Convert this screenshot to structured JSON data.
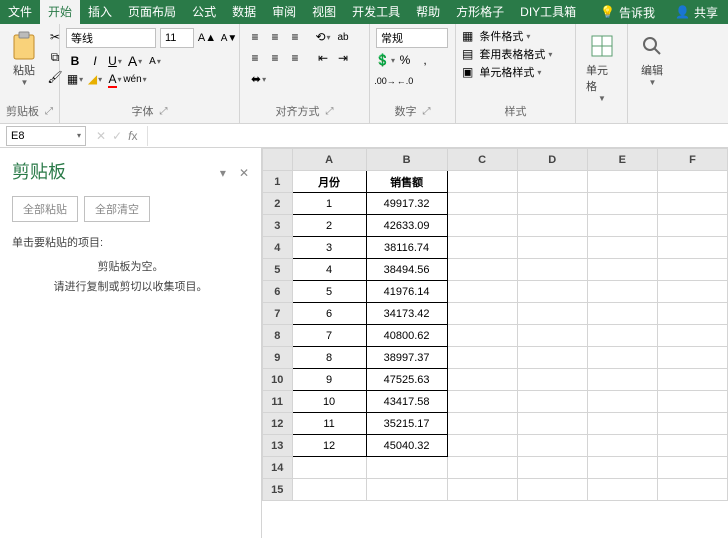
{
  "menu": {
    "items": [
      "文件",
      "开始",
      "插入",
      "页面布局",
      "公式",
      "数据",
      "审阅",
      "视图",
      "开发工具",
      "帮助",
      "方形格子",
      "DIY工具箱"
    ],
    "active_index": 1,
    "tell_me": "告诉我",
    "share": "共享"
  },
  "ribbon": {
    "clipboard": {
      "paste": "粘贴",
      "label": "剪贴板"
    },
    "font": {
      "name": "等线",
      "size": "11",
      "label": "字体"
    },
    "align": {
      "label": "对齐方式"
    },
    "number": {
      "format": "常规",
      "label": "数字"
    },
    "styles": {
      "cond": "条件格式",
      "table": "套用表格格式",
      "cell": "单元格样式",
      "label": "样式"
    },
    "cells": {
      "label": "单元格"
    },
    "editing": {
      "label": "编辑"
    }
  },
  "namebox": "E8",
  "pane": {
    "title": "剪贴板",
    "paste_all": "全部粘贴",
    "clear_all": "全部清空",
    "click_hint": "单击要粘贴的项目:",
    "empty": "剪贴板为空。",
    "copy_hint": "请进行复制或剪切以收集项目。"
  },
  "sheet": {
    "headers": {
      "A": "月份",
      "B": "销售额"
    },
    "rows": [
      {
        "A": "1",
        "B": "49917.32"
      },
      {
        "A": "2",
        "B": "42633.09"
      },
      {
        "A": "3",
        "B": "38116.74"
      },
      {
        "A": "4",
        "B": "38494.56"
      },
      {
        "A": "5",
        "B": "41976.14"
      },
      {
        "A": "6",
        "B": "34173.42"
      },
      {
        "A": "7",
        "B": "40800.62"
      },
      {
        "A": "8",
        "B": "38997.37"
      },
      {
        "A": "9",
        "B": "47525.63"
      },
      {
        "A": "10",
        "B": "43417.58"
      },
      {
        "A": "11",
        "B": "35215.17"
      },
      {
        "A": "12",
        "B": "45040.32"
      }
    ],
    "cols": [
      "A",
      "B",
      "C",
      "D",
      "E",
      "F"
    ]
  },
  "chart_data": {
    "type": "table",
    "title": "销售额 by 月份",
    "xlabel": "月份",
    "ylabel": "销售额",
    "categories": [
      1,
      2,
      3,
      4,
      5,
      6,
      7,
      8,
      9,
      10,
      11,
      12
    ],
    "values": [
      49917.32,
      42633.09,
      38116.74,
      38494.56,
      41976.14,
      34173.42,
      40800.62,
      38997.37,
      47525.63,
      43417.58,
      35215.17,
      45040.32
    ]
  }
}
